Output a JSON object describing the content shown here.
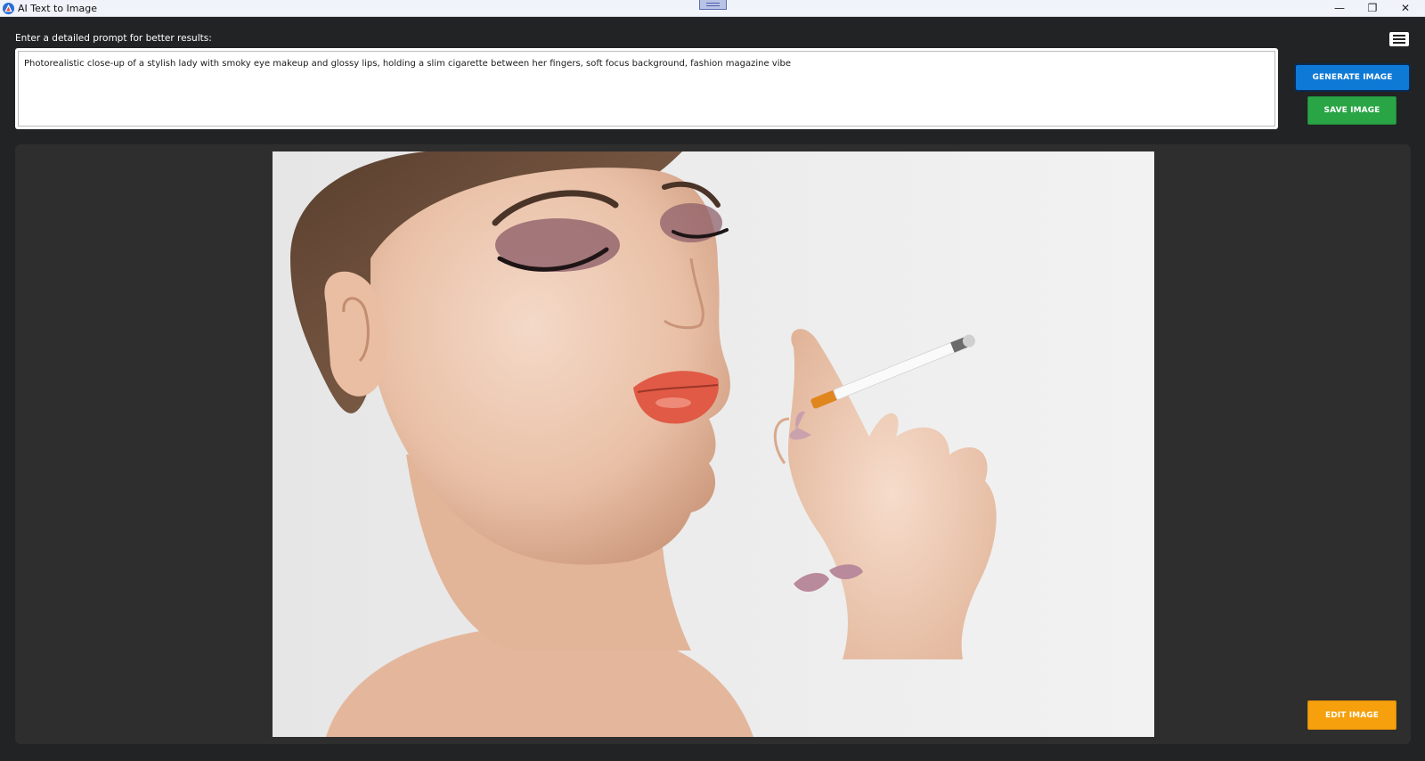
{
  "window": {
    "title": "AI Text to Image",
    "minimize_glyph": "—",
    "maximize_glyph": "❐",
    "close_glyph": "✕"
  },
  "prompt": {
    "label": "Enter a detailed prompt for better results:",
    "value": "Photorealistic close-up of a stylish lady with smoky eye makeup and glossy lips, holding a slim cigarette between her fingers, soft focus background, fashion magazine vibe"
  },
  "buttons": {
    "generate": "GENERATE IMAGE",
    "save": "SAVE IMAGE",
    "edit": "EDIT IMAGE"
  },
  "icons": {
    "app": "app-logo-icon",
    "menu": "hamburger-menu-icon"
  },
  "colors": {
    "generate": "#0f79d6",
    "save": "#2aa546",
    "edit": "#f5a00c",
    "background": "#222324",
    "panel": "#2e2e2e"
  }
}
